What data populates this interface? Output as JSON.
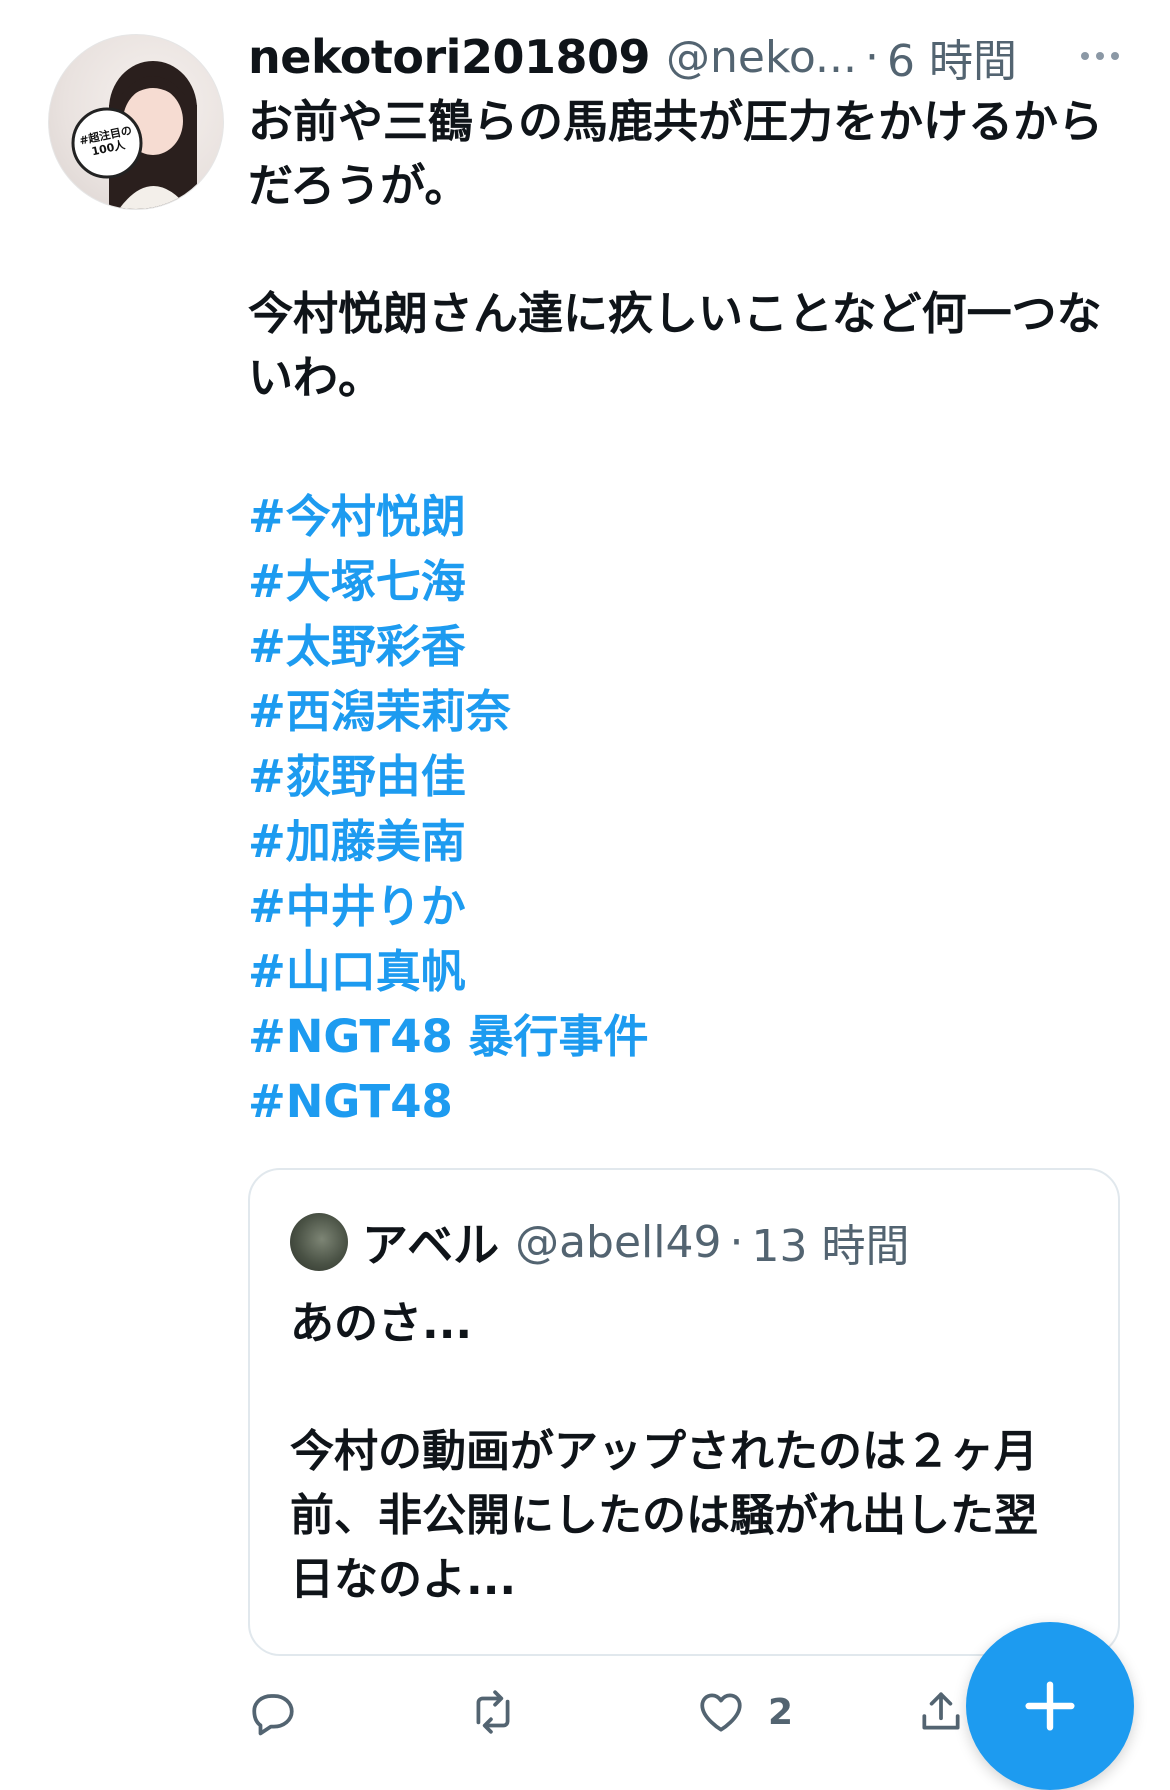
{
  "tweet": {
    "author": {
      "display_name": "nekotori201809",
      "handle": "@neko...",
      "avatar_badge": "#超注目の100人"
    },
    "separator": "·",
    "time": "6 時間",
    "paragraphs": [
      "お前や三鶴らの馬鹿共が圧力をかけるからだろうが。",
      "今村悦朗さん達に疚しいことなど何一つないわ。"
    ],
    "hashtags": [
      "#今村悦朗",
      "#大塚七海",
      "#太野彩香",
      "#西潟茉莉奈",
      "#荻野由佳",
      "#加藤美南",
      "#中井りか",
      "#山口真帆",
      "#NGT48 暴行事件",
      "#NGT48"
    ]
  },
  "quote": {
    "display_name": "アベル",
    "handle": "@abell49",
    "separator": "·",
    "time": "13 時間",
    "paragraphs": [
      "あのさ...",
      "今村の動画がアップされたのは２ヶ月前、非公開にしたのは騒がれ出した翌日なのよ..."
    ]
  },
  "actions": {
    "reply_icon": "reply-icon",
    "retweet_icon": "retweet-icon",
    "like_icon": "heart-icon",
    "like_count": "2",
    "share_icon": "share-icon"
  },
  "fab": {
    "icon": "plus-icon"
  },
  "colors": {
    "link": "#1d9bf0",
    "secondary_text": "#536471",
    "fab_background": "#1d9bf0"
  }
}
